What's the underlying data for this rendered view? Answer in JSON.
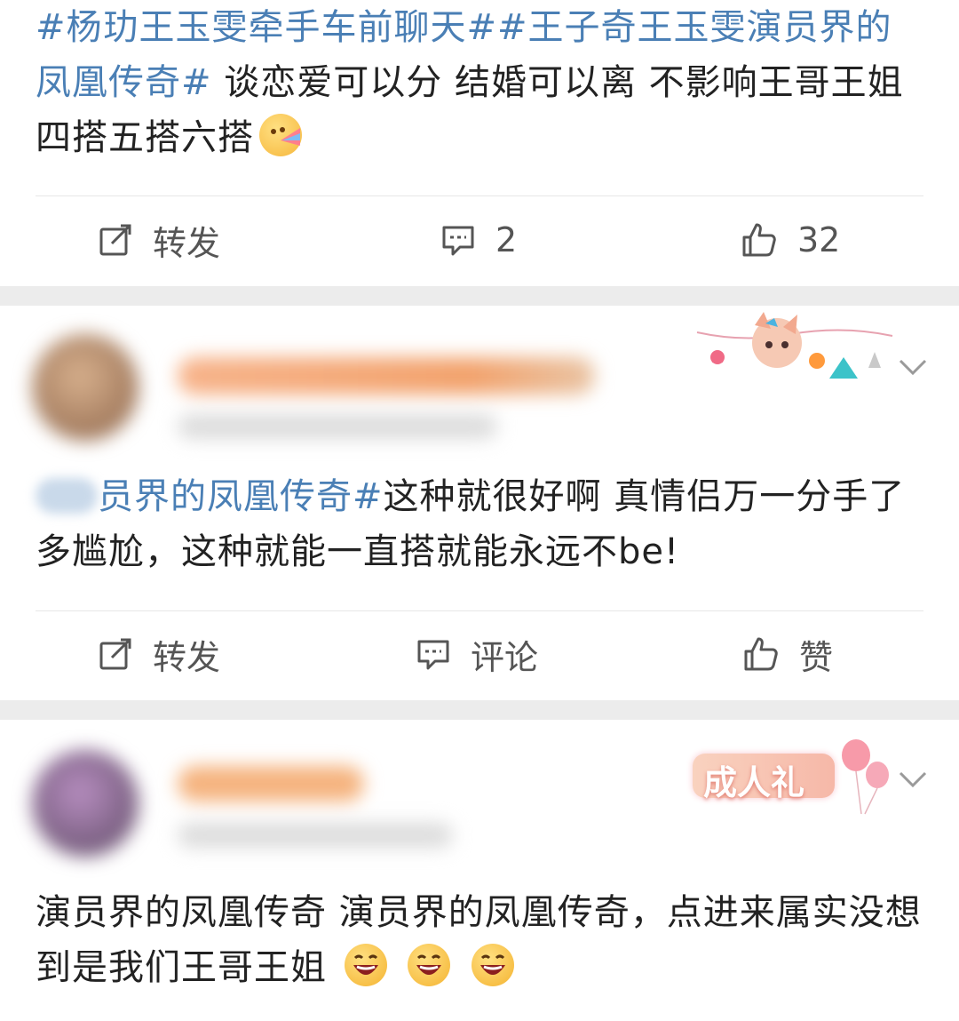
{
  "post1": {
    "hashtag1": "#杨玏王玉雯牵手车前聊天#",
    "hashtag2": "#王子奇王玉雯演员界的凤凰传奇#",
    "body": " 谈恋爱可以分 结婚可以离 不影响王哥王姐四搭五搭六搭",
    "emoji": "rainbow-vomit-emoji",
    "repost_label": "转发",
    "comment_count": "2",
    "like_count": "32"
  },
  "post2": {
    "hashtag": "员界的凤凰传奇#",
    "body": "这种就很好啊 真情侣万一分手了多尴尬，这种就能一直搭就能永远不be!",
    "repost_label": "转发",
    "comment_label": "评论",
    "like_label": "赞",
    "decoration": "linabell-party-banner"
  },
  "post3": {
    "body": "演员界的凤凰传奇  演员界的凤凰传奇，点进来属实没想到是我们王哥王姐",
    "emojis": [
      "laughing-emoji",
      "laughing-emoji",
      "laughing-emoji"
    ],
    "badge_text": "成人礼",
    "decoration": "balloon-badge"
  },
  "colors": {
    "accent": "#4a7fb5",
    "separator": "#ececec",
    "icon": "#555555"
  }
}
